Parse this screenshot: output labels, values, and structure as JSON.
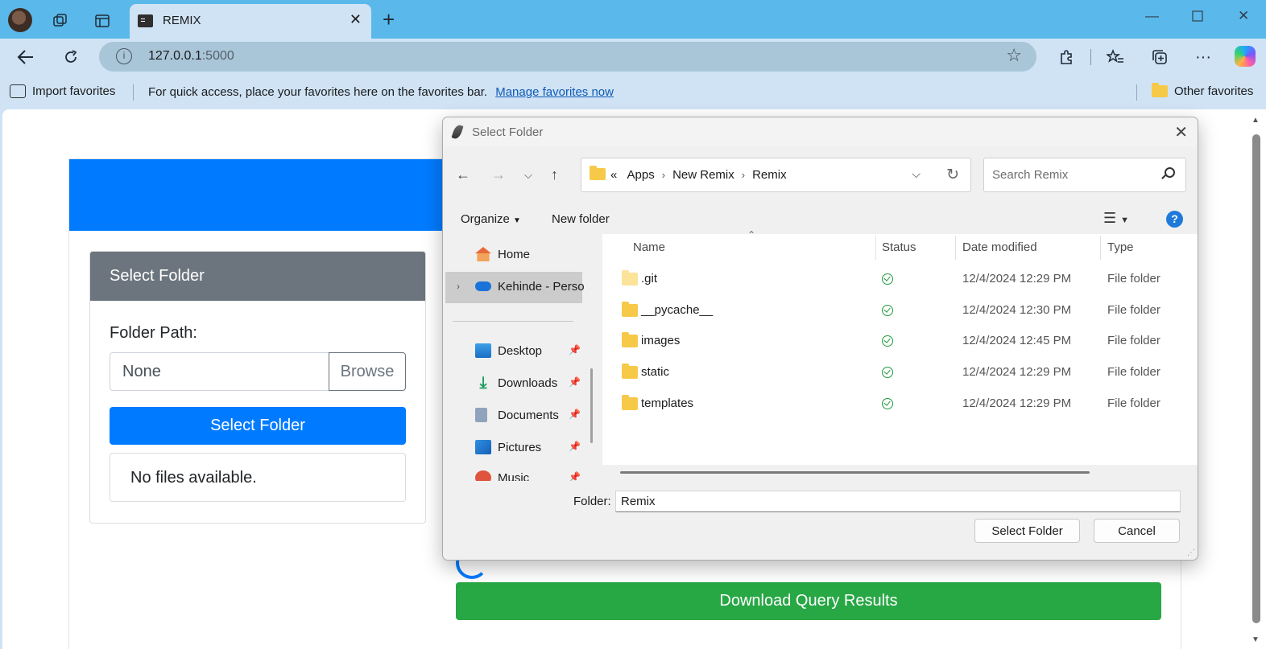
{
  "browser": {
    "tab_title": "REMIX",
    "url_host": "127.0.0.1",
    "url_port": ":5000",
    "favorites": {
      "import_label": "Import favorites",
      "message": "For quick access, place your favorites here on the favorites bar.",
      "manage_link": "Manage favorites now",
      "other_label": "Other favorites"
    },
    "icons": {
      "tab_actions": "tab-actions-icon",
      "vertical_tabs": "vertical-tabs-icon",
      "new_tab": "plus-icon",
      "back": "back-arrow-icon",
      "refresh": "refresh-icon",
      "extensions": "puzzle-icon",
      "favorites": "favorites-icon",
      "collections": "collections-icon",
      "more": "more-icon",
      "copilot": "copilot-icon"
    }
  },
  "page": {
    "select_card": {
      "title": "Select Folder",
      "path_label": "Folder Path:",
      "path_value": "None",
      "browse_label": "Browse",
      "select_button": "Select Folder",
      "empty_message": "No files available."
    },
    "download_button": "Download Query Results",
    "colors": {
      "header": "#007bff",
      "primary": "#007bff",
      "success": "#28a745",
      "card_header": "#6c757d"
    }
  },
  "dialog": {
    "title": "Select Folder",
    "address": {
      "overflow": "«",
      "crumbs": [
        "Apps",
        "New Remix",
        "Remix"
      ]
    },
    "search_placeholder": "Search Remix",
    "commands": {
      "organize": "Organize",
      "new_folder": "New folder"
    },
    "nav": {
      "home": "Home",
      "onedrive": "Kehinde - Perso",
      "desktop": "Desktop",
      "downloads": "Downloads",
      "documents": "Documents",
      "pictures": "Pictures",
      "music": "Music"
    },
    "columns": [
      "Name",
      "Status",
      "Date modified",
      "Type"
    ],
    "rows": [
      {
        "name": ".git",
        "date": "12/4/2024 12:29 PM",
        "type": "File folder"
      },
      {
        "name": "__pycache__",
        "date": "12/4/2024 12:30 PM",
        "type": "File folder"
      },
      {
        "name": "images",
        "date": "12/4/2024 12:45 PM",
        "type": "File folder"
      },
      {
        "name": "static",
        "date": "12/4/2024 12:29 PM",
        "type": "File folder"
      },
      {
        "name": "templates",
        "date": "12/4/2024 12:29 PM",
        "type": "File folder"
      }
    ],
    "folder_label": "Folder:",
    "folder_value": "Remix",
    "select_button": "Select Folder",
    "cancel_button": "Cancel"
  }
}
